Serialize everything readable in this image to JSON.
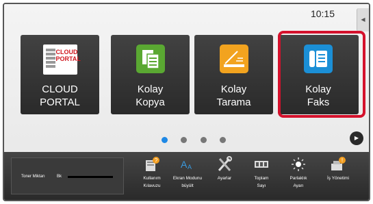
{
  "clock": "10:15",
  "tiles": [
    {
      "label": "CLOUD PORTAL",
      "logo_line1": "CLOUD",
      "logo_line2": "PORTAL"
    },
    {
      "label": "Kolay\nKopya",
      "color": "#5aa832"
    },
    {
      "label": "Kolay\nTarama",
      "color": "#f2a31f"
    },
    {
      "label": "Kolay\nFaks",
      "color": "#1b8fd6"
    }
  ],
  "highlight_color": "#d4112c",
  "page_indicator": {
    "pages": 4,
    "current": 1,
    "active_color": "#1e88e5"
  },
  "toner": {
    "label": "Toner Miktarı",
    "color_label": "Bk"
  },
  "bottom_items": [
    {
      "label": "Kullanım\nKılavuzu",
      "icon": "book-icon"
    },
    {
      "label": "Ekran Modunu\nbüyült",
      "icon": "text-zoom-icon"
    },
    {
      "label": "Ayarlar",
      "icon": "tools-icon"
    },
    {
      "label": "Toplam\nSayı",
      "icon": "counter-icon"
    },
    {
      "label": "Parlaklık\nAyarı",
      "icon": "brightness-icon"
    },
    {
      "label": "İş Yönetimi",
      "icon": "job-status-icon"
    }
  ]
}
